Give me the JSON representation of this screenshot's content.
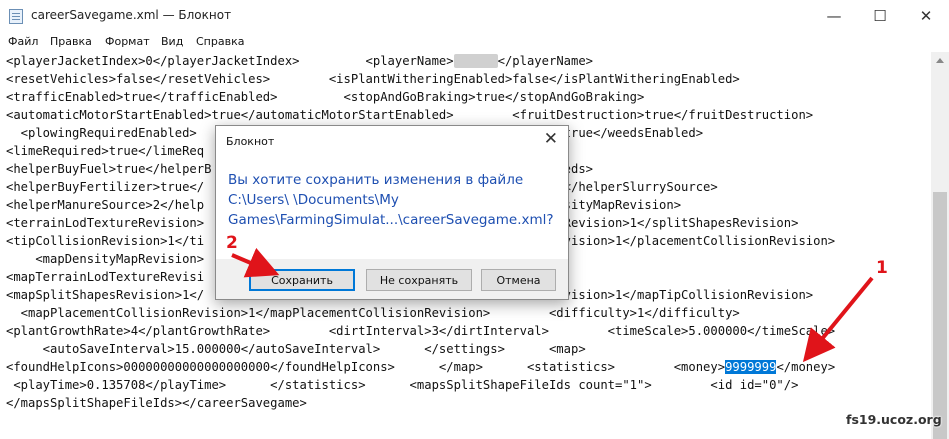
{
  "window": {
    "title": "careerSavegame.xml — Блокнот",
    "minimize_glyph": "—",
    "maximize_glyph": "☐",
    "close_glyph": "✕"
  },
  "menu": [
    "Файл",
    "Правка",
    "Формат",
    "Вид",
    "Справка"
  ],
  "editor": {
    "lines": [
      [
        "<playerJacketIndex>0</playerJacketIndex>         <playerName>",
        "",
        "</playerName>"
      ],
      [
        "<resetVehicles>false</resetVehicles>        <isPlantWitheringEnabled>false</isPlantWitheringEnabled>"
      ],
      [
        "<trafficEnabled>true</trafficEnabled>         <stopAndGoBraking>true</stopAndGoBraking>"
      ],
      [
        "<automaticMotorStartEnabled>true</automaticMotorStartEnabled>        <fruitDestruction>true</fruitDestruction>"
      ],
      [
        "  <plowingRequiredEnabled>                                           nabled>true</weedsEnabled>"
      ],
      [
        "<limeRequired>true</limeReq                                           Low>"
      ],
      [
        "<helperBuyFuel>true</helperB                                          rBuySeeds>"
      ],
      [
        "<helperBuyFertilizer>true</                                           urce>2</helperSlurrySource>"
      ],
      [
        "<helperManureSource>2</help                                           3</densityMapRevision>"
      ],
      [
        "<terrainLodTextureRevision>                                           ShapesRevision>1</splitShapesRevision>"
      ],
      [
        "<tipCollisionRevision>1</ti                                           sionRevision>1</placementCollisionRevision>"
      ],
      [
        "    <mapDensityMapRevision>"
      ],
      [
        "<mapTerrainLodTextureRevisi"
      ],
      [
        "<mapSplitShapesRevision>1</                                           sionRevision>1</mapTipCollisionRevision>"
      ],
      [
        "  <mapPlacementCollisionRevision>1</mapPlacementCollisionRevision>        <difficulty>1</difficulty>"
      ],
      [
        "<plantGrowthRate>4</plantGrowthRate>        <dirtInterval>3</dirtInterval>        <timeScale>5.000000</timeScale>"
      ],
      [
        "     <autoSaveInterval>15.000000</autoSaveInterval>      </settings>      <map>"
      ],
      [
        "<foundHelpIcons>00000000000000000000</foundHelpIcons>      </map>      <statistics>        <money>",
        "9999999",
        "</money>"
      ],
      [
        " <playTime>0.135708</playTime>      </statistics>      <mapsSplitShapeFileIds count=\"1\">        <id id=\"0\"/>"
      ],
      [
        "</mapsSplitShapeFileIds></careerSavegame>"
      ]
    ],
    "selected_text": "9999999"
  },
  "dialog": {
    "title": "Блокнот",
    "close_glyph": "✕",
    "message_lines": [
      "Вы хотите сохранить изменения в файле",
      "C:\\Users\\        \\Documents\\My",
      "Games\\FarmingSimulat...\\careerSavegame.xml?"
    ],
    "buttons": {
      "save": "Сохранить",
      "dont_save": "Не сохранять",
      "cancel": "Отмена"
    }
  },
  "annotations": {
    "step1": "1",
    "step2": "2",
    "arrow_color": "#e0141a"
  },
  "watermark": "fs19.ucoz.org"
}
